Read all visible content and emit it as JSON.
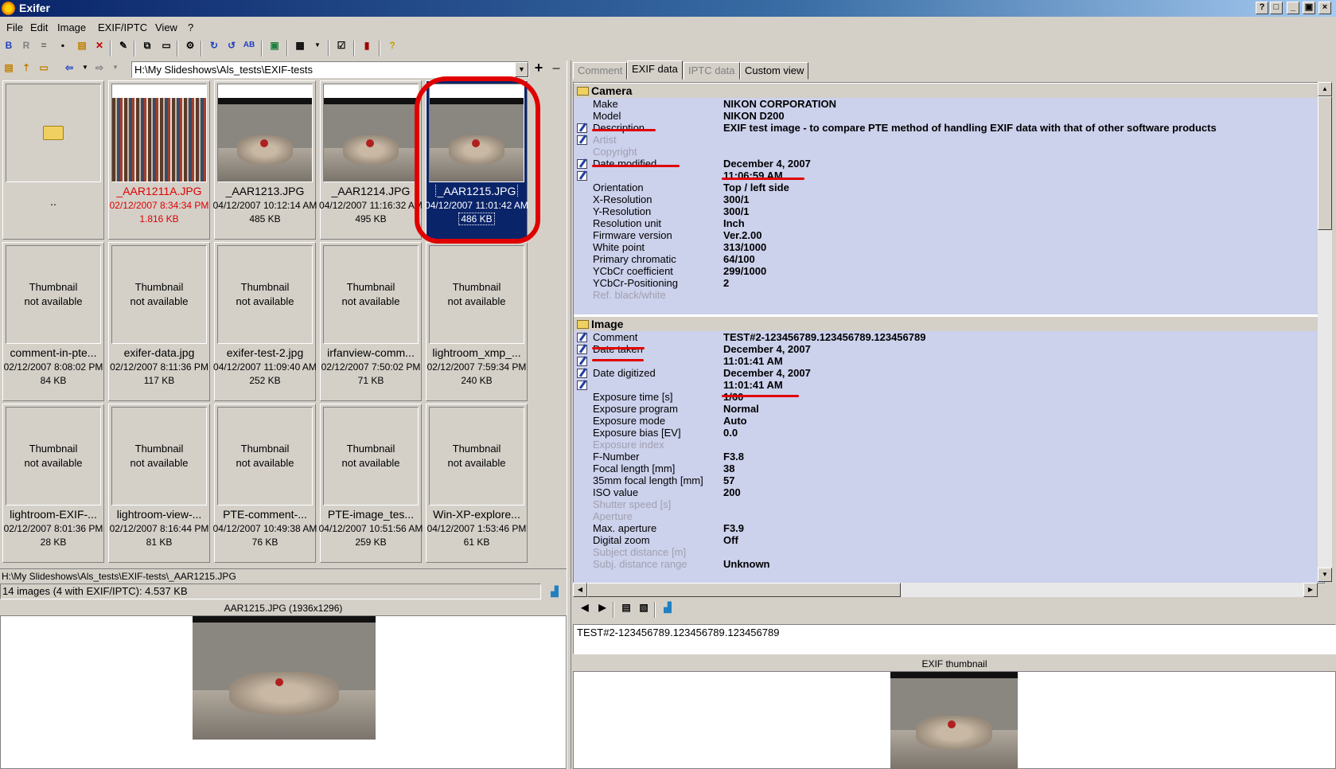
{
  "window": {
    "title": "Exifer",
    "controls": [
      "?",
      "□",
      "_",
      "▣",
      "×"
    ]
  },
  "menu": [
    "File",
    "Edit",
    "Image",
    "EXIF/IPTC",
    "View",
    "?"
  ],
  "toolbar2": {
    "path": "H:\\My Slideshows\\Als_tests\\EXIF-tests"
  },
  "files": [
    {
      "name": "..",
      "date": "",
      "size": "",
      "thumb": "folder"
    },
    {
      "name": "_AAR1211A.JPG",
      "date": "02/12/2007 8:34:34 PM",
      "size": "1.816 KB",
      "thumb": "books",
      "red": true
    },
    {
      "name": "_AAR1213.JPG",
      "date": "04/12/2007 10:12:14 AM",
      "size": "485 KB",
      "thumb": "sofa"
    },
    {
      "name": "_AAR1214.JPG",
      "date": "04/12/2007 11:16:32 AM",
      "size": "495 KB",
      "thumb": "sofa"
    },
    {
      "name": "_AAR1215.JPG",
      "date": "04/12/2007 11:01:42 AM",
      "size": "486 KB",
      "thumb": "sofa",
      "selected": true
    },
    {
      "name": "comment-in-pte...",
      "date": "02/12/2007 8:08:02 PM",
      "size": "84 KB",
      "thumb": "na"
    },
    {
      "name": "exifer-data.jpg",
      "date": "02/12/2007 8:11:36 PM",
      "size": "117 KB",
      "thumb": "na"
    },
    {
      "name": "exifer-test-2.jpg",
      "date": "04/12/2007 11:09:40 AM",
      "size": "252 KB",
      "thumb": "na"
    },
    {
      "name": "irfanview-comm...",
      "date": "02/12/2007 7:50:02 PM",
      "size": "71 KB",
      "thumb": "na"
    },
    {
      "name": "lightroom_xmp_...",
      "date": "02/12/2007 7:59:34 PM",
      "size": "240 KB",
      "thumb": "na"
    },
    {
      "name": "lightroom-EXIF-...",
      "date": "02/12/2007 8:01:36 PM",
      "size": "28 KB",
      "thumb": "na"
    },
    {
      "name": "lightroom-view-...",
      "date": "02/12/2007 8:16:44 PM",
      "size": "81 KB",
      "thumb": "na"
    },
    {
      "name": "PTE-comment-...",
      "date": "04/12/2007 10:49:38 AM",
      "size": "76 KB",
      "thumb": "na"
    },
    {
      "name": "PTE-image_tes...",
      "date": "04/12/2007 10:51:56 AM",
      "size": "259 KB",
      "thumb": "na"
    },
    {
      "name": "Win-XP-explore...",
      "date": "04/12/2007 1:53:46 PM",
      "size": "61 KB",
      "thumb": "na"
    }
  ],
  "thumb_na_line1": "Thumbnail",
  "thumb_na_line2": "not available",
  "status": {
    "path": "H:\\My Slideshows\\Als_tests\\EXIF-tests\\_AAR1215.JPG",
    "count": "14 images (4 with EXIF/IPTC): 4.537 KB"
  },
  "preview_caption": "AAR1215.JPG (1936x1296)",
  "tabs": [
    "Comment",
    "EXIF data",
    "IPTC data",
    "Custom view"
  ],
  "camera_section": "Camera",
  "camera_rows": [
    {
      "k": "Make",
      "v": "NIKON CORPORATION",
      "ed": false,
      "dis": false
    },
    {
      "k": "Model",
      "v": "NIKON D200",
      "ed": false,
      "dis": false
    },
    {
      "k": "Description",
      "v": "EXIF test image - to compare PTE method of handling EXIF data with that of other software products",
      "ed": true,
      "dis": false
    },
    {
      "k": "Artist",
      "v": "",
      "ed": true,
      "dis": true
    },
    {
      "k": "Copyright",
      "v": "",
      "ed": false,
      "dis": true
    },
    {
      "k": "Date modified",
      "v": "December 4, 2007",
      "ed": true,
      "dis": false
    },
    {
      "k": "",
      "v": "11:06:59 AM",
      "ed": true,
      "dis": false
    },
    {
      "k": "Orientation",
      "v": "Top / left side",
      "ed": false,
      "dis": false
    },
    {
      "k": "X-Resolution",
      "v": "300/1",
      "ed": false,
      "dis": false
    },
    {
      "k": "Y-Resolution",
      "v": "300/1",
      "ed": false,
      "dis": false
    },
    {
      "k": "Resolution unit",
      "v": "Inch",
      "ed": false,
      "dis": false
    },
    {
      "k": "Firmware version",
      "v": "Ver.2.00",
      "ed": false,
      "dis": false
    },
    {
      "k": "White point",
      "v": "313/1000",
      "ed": false,
      "dis": false
    },
    {
      "k": "Primary chromatic",
      "v": "64/100",
      "ed": false,
      "dis": false
    },
    {
      "k": "YCbCr coefficient",
      "v": "299/1000",
      "ed": false,
      "dis": false
    },
    {
      "k": "YCbCr-Positioning",
      "v": "2",
      "ed": false,
      "dis": false
    },
    {
      "k": "Ref. black/white",
      "v": "",
      "ed": false,
      "dis": true
    }
  ],
  "image_section": "Image",
  "image_rows": [
    {
      "k": "Comment",
      "v": "TEST#2-123456789.123456789.123456789",
      "ed": true,
      "dis": false
    },
    {
      "k": "Date taken",
      "v": "December 4, 2007",
      "ed": true,
      "dis": false
    },
    {
      "k": "",
      "v": "11:01:41 AM",
      "ed": true,
      "dis": false
    },
    {
      "k": "Date digitized",
      "v": "December 4, 2007",
      "ed": true,
      "dis": false
    },
    {
      "k": "",
      "v": "11:01:41 AM",
      "ed": true,
      "dis": false
    },
    {
      "k": "Exposure time [s]",
      "v": "1/60",
      "ed": false,
      "dis": false
    },
    {
      "k": "Exposure program",
      "v": "Normal",
      "ed": false,
      "dis": false
    },
    {
      "k": "Exposure mode",
      "v": "Auto",
      "ed": false,
      "dis": false
    },
    {
      "k": "Exposure bias [EV]",
      "v": "0.0",
      "ed": false,
      "dis": false
    },
    {
      "k": "Exposure index",
      "v": "",
      "ed": false,
      "dis": true
    },
    {
      "k": "F-Number",
      "v": "F3.8",
      "ed": false,
      "dis": false
    },
    {
      "k": "Focal length [mm]",
      "v": "38",
      "ed": false,
      "dis": false
    },
    {
      "k": "35mm focal length [mm]",
      "v": "57",
      "ed": false,
      "dis": false
    },
    {
      "k": "ISO value",
      "v": "200",
      "ed": false,
      "dis": false
    },
    {
      "k": "Shutter speed [s]",
      "v": "",
      "ed": false,
      "dis": true
    },
    {
      "k": "Aperture",
      "v": "",
      "ed": false,
      "dis": true
    },
    {
      "k": "Max. aperture",
      "v": "F3.9",
      "ed": false,
      "dis": false
    },
    {
      "k": "Digital zoom",
      "v": "Off",
      "ed": false,
      "dis": false
    },
    {
      "k": "Subject distance [m]",
      "v": "",
      "ed": false,
      "dis": true
    },
    {
      "k": "Subj. distance range",
      "v": "Unknown",
      "ed": false,
      "dis": true
    }
  ],
  "comment_text": "TEST#2-123456789.123456789.123456789",
  "exif_thumb_caption": "EXIF thumbnail",
  "colors": {
    "selection": "#0a246a",
    "highlight_red": "#e00000",
    "exif_bg": "#ccd1ec"
  }
}
